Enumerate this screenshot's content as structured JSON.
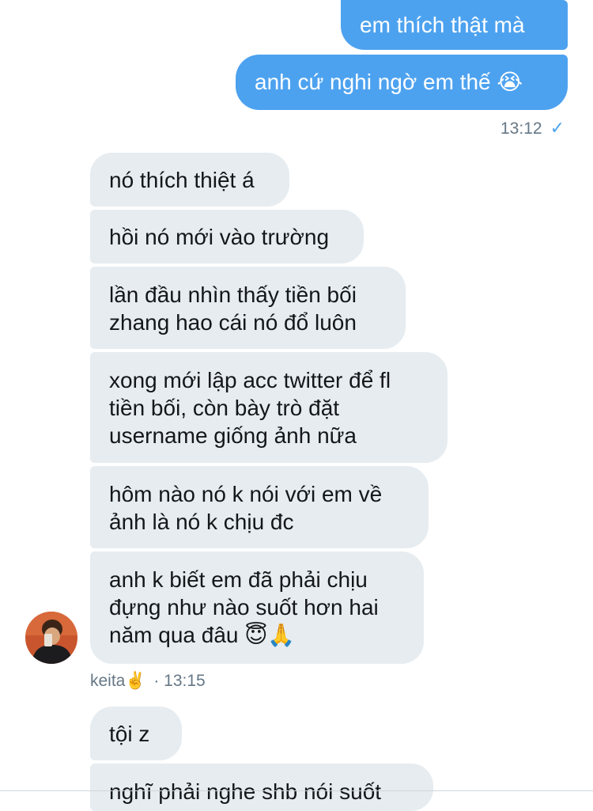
{
  "outgoing": {
    "messages": [
      "em thích thật mà",
      "anh cứ nghi ngờ em thế 😭"
    ],
    "time": "13:12",
    "status_icon": "✓"
  },
  "incoming": {
    "messages": [
      "nó thích thiệt á",
      "hồi nó mới vào trường",
      "lần đầu nhìn thấy tiền bối\nzhang hao cái nó đổ luôn",
      "xong mới lập acc twitter để fl\ntiền bối, còn bày trò đặt\nusername giống ảnh nữa",
      "hôm nào nó k nói với em về\nảnh là nó k chịu đc",
      "anh k biết em đã phải chịu\nđựng như nào suốt hơn hai\nnăm qua đâu 😇🙏"
    ],
    "sender": "keita✌️",
    "time": "· 13:15"
  },
  "incoming2": {
    "messages": [
      "tội z",
      "nghĩ phải nghe shb nói suốt"
    ]
  },
  "colors": {
    "outgoing_bubble": "#4da2ef",
    "incoming_bubble": "#e6ecf0",
    "meta_text": "#657786"
  }
}
